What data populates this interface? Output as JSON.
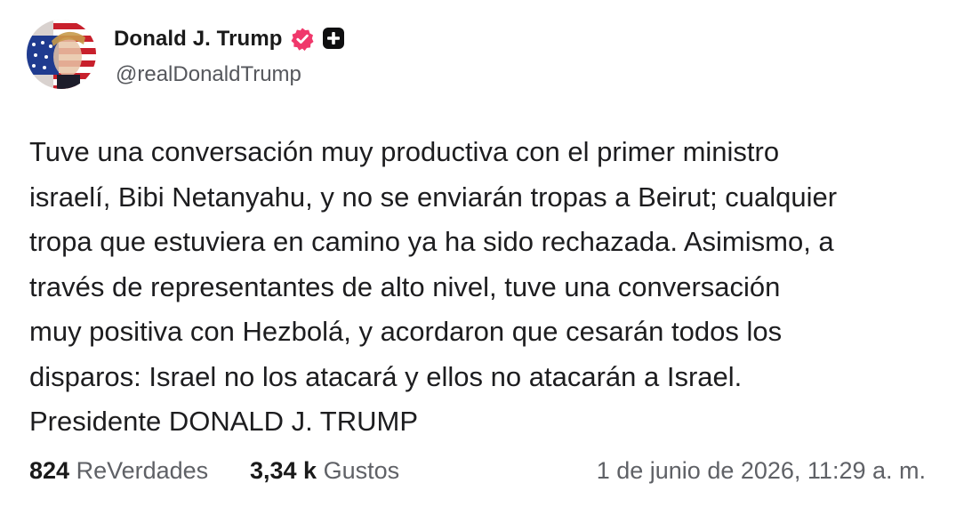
{
  "author": {
    "display_name": "Donald J. Trump",
    "handle": "@realDonaldTrump",
    "avatar_icon": "avatar-flag-portrait",
    "verified_badge_color": "#f0386b"
  },
  "post": {
    "text": "Tuve una conversación muy productiva con el primer ministro\nisraelí, Bibi Netanyahu, y no se enviarán tropas a Beirut; cualquier\ntropa que estuviera en camino ya ha sido rechazada. Asimismo, a\ntravés de representantes de alto nivel, tuve una conversación\nmuy positiva con Hezbolá, y acordaron que cesarán todos los\ndisparos: Israel no los atacará y ellos no atacarán a Israel.\nPresidente DONALD J. TRUMP"
  },
  "stats": {
    "retruths_count": "824",
    "retruths_label": "ReVerdades",
    "likes_count": "3,34 k",
    "likes_label": "Gustos"
  },
  "timestamp": "1 de junio de 2026, 11:29 a. m."
}
